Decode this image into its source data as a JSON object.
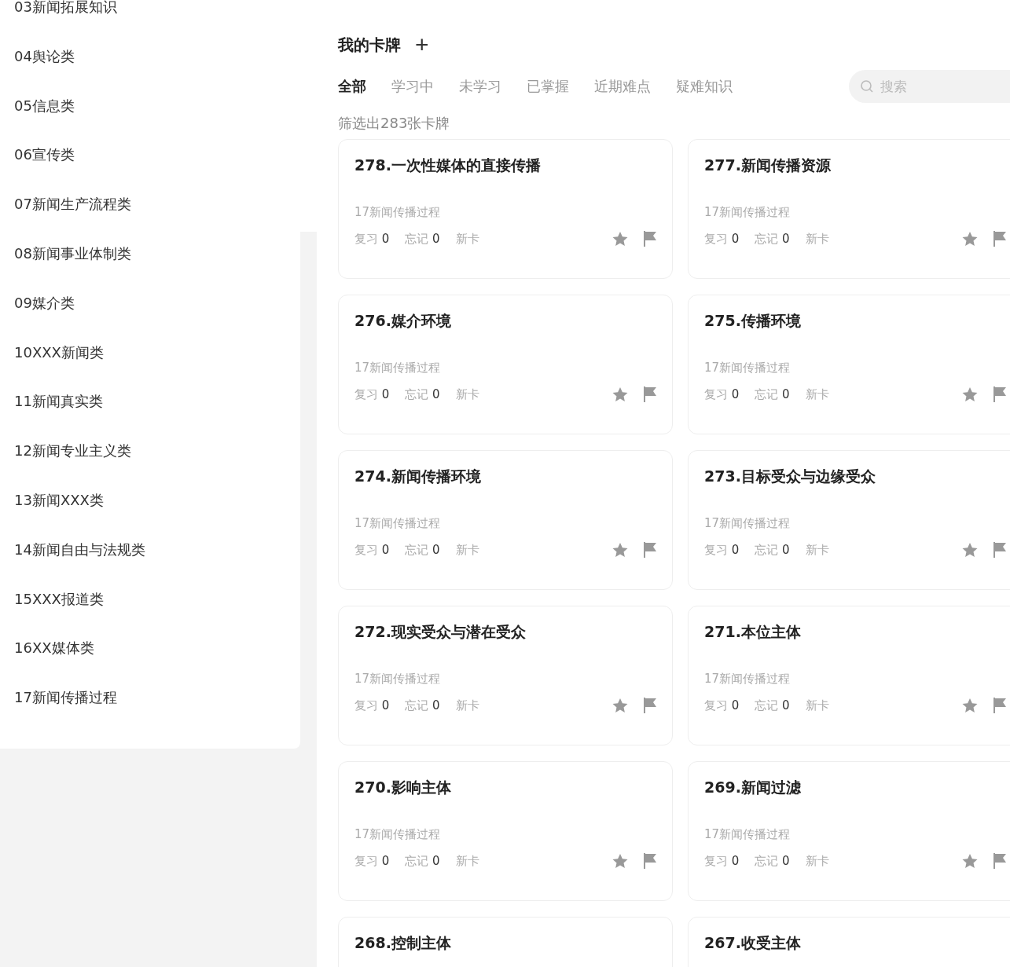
{
  "sidebar": {
    "items": [
      {
        "label": "03新闻拓展知识"
      },
      {
        "label": "04舆论类"
      },
      {
        "label": "05信息类"
      },
      {
        "label": "06宣传类"
      },
      {
        "label": "07新闻生产流程类"
      },
      {
        "label": "08新闻事业体制类"
      },
      {
        "label": "09媒介类"
      },
      {
        "label": "10XXX新闻类"
      },
      {
        "label": "11新闻真实类"
      },
      {
        "label": "12新闻专业主义类"
      },
      {
        "label": "13新闻XXX类"
      },
      {
        "label": "14新闻自由与法规类"
      },
      {
        "label": "15XXX报道类"
      },
      {
        "label": "16XX媒体类"
      },
      {
        "label": "17新闻传播过程"
      }
    ]
  },
  "header": {
    "title": "我的卡牌",
    "add_icon": "+"
  },
  "tabs": [
    {
      "label": "全部",
      "selected": true
    },
    {
      "label": "学习中",
      "selected": false
    },
    {
      "label": "未学习",
      "selected": false
    },
    {
      "label": "已掌握",
      "selected": false
    },
    {
      "label": "近期难点",
      "selected": false
    },
    {
      "label": "疑难知识",
      "selected": false
    }
  ],
  "search": {
    "placeholder": "搜索"
  },
  "filter_count": "筛选出283张卡牌",
  "cards": [
    {
      "title": "278.一次性媒体的直接传播",
      "category": "17新闻传播过程",
      "review_label": "复习",
      "review_count": "0",
      "forget_label": "忘记",
      "forget_count": "0",
      "status": "新卡"
    },
    {
      "title": "277.新闻传播资源",
      "category": "17新闻传播过程",
      "review_label": "复习",
      "review_count": "0",
      "forget_label": "忘记",
      "forget_count": "0",
      "status": "新卡"
    },
    {
      "title": "276.媒介环境",
      "category": "17新闻传播过程",
      "review_label": "复习",
      "review_count": "0",
      "forget_label": "忘记",
      "forget_count": "0",
      "status": "新卡"
    },
    {
      "title": "275.传播环境",
      "category": "17新闻传播过程",
      "review_label": "复习",
      "review_count": "0",
      "forget_label": "忘记",
      "forget_count": "0",
      "status": "新卡"
    },
    {
      "title": "274.新闻传播环境",
      "category": "17新闻传播过程",
      "review_label": "复习",
      "review_count": "0",
      "forget_label": "忘记",
      "forget_count": "0",
      "status": "新卡"
    },
    {
      "title": "273.目标受众与边缘受众",
      "category": "17新闻传播过程",
      "review_label": "复习",
      "review_count": "0",
      "forget_label": "忘记",
      "forget_count": "0",
      "status": "新卡"
    },
    {
      "title": "272.现实受众与潜在受众",
      "category": "17新闻传播过程",
      "review_label": "复习",
      "review_count": "0",
      "forget_label": "忘记",
      "forget_count": "0",
      "status": "新卡"
    },
    {
      "title": "271.本位主体",
      "category": "17新闻传播过程",
      "review_label": "复习",
      "review_count": "0",
      "forget_label": "忘记",
      "forget_count": "0",
      "status": "新卡"
    },
    {
      "title": "270.影响主体",
      "category": "17新闻传播过程",
      "review_label": "复习",
      "review_count": "0",
      "forget_label": "忘记",
      "forget_count": "0",
      "status": "新卡"
    },
    {
      "title": "269.新闻过滤",
      "category": "17新闻传播过程",
      "review_label": "复习",
      "review_count": "0",
      "forget_label": "忘记",
      "forget_count": "0",
      "status": "新卡"
    },
    {
      "title": "268.控制主体"
    },
    {
      "title": "267.收受主体"
    }
  ]
}
